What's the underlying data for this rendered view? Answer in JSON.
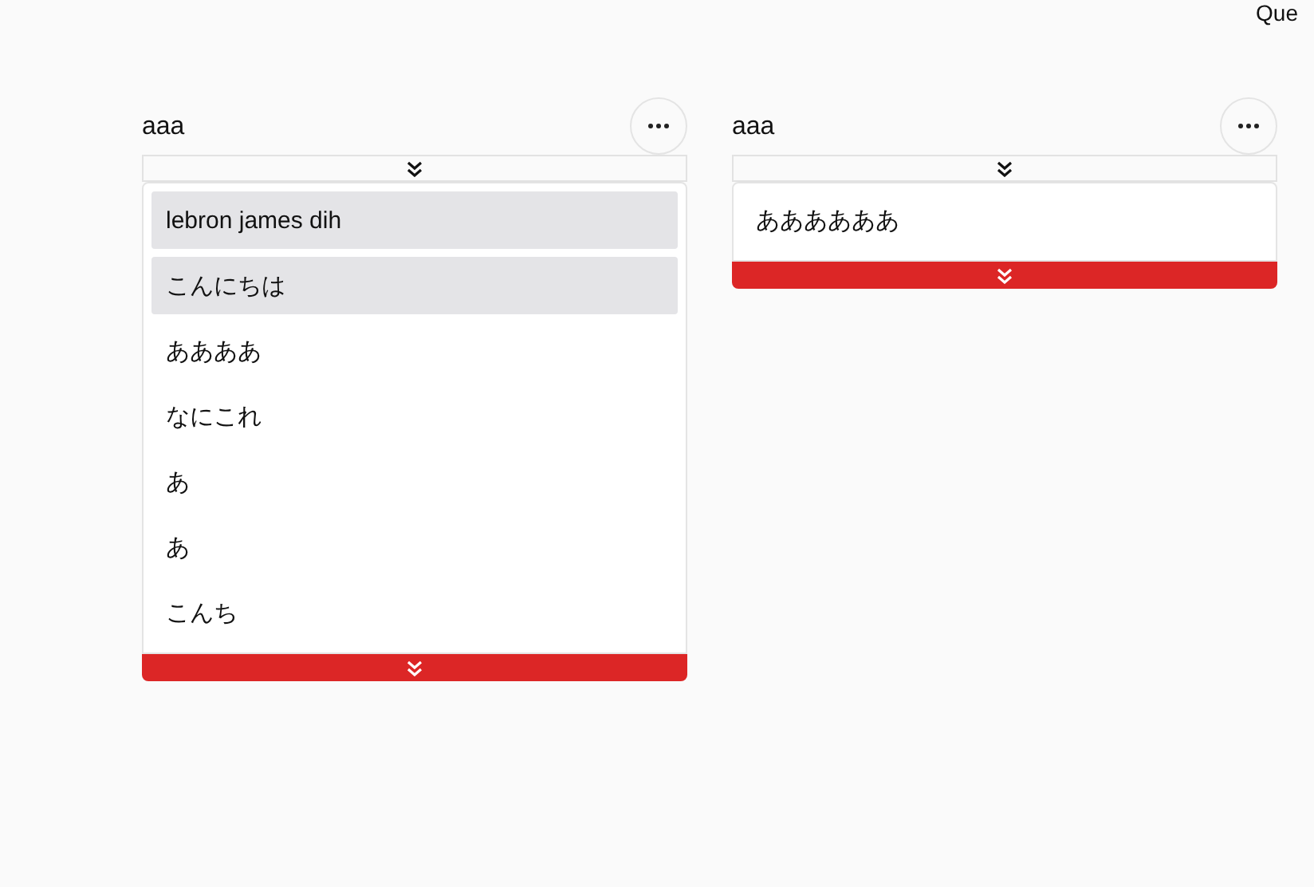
{
  "header": {
    "text": "Que"
  },
  "columns": [
    {
      "title": "aaa",
      "items": [
        {
          "label": "lebron james dih",
          "selected": true
        },
        {
          "label": "こんにちは",
          "selected": true
        },
        {
          "label": "ああああ",
          "selected": false
        },
        {
          "label": "なにこれ",
          "selected": false
        },
        {
          "label": "あ",
          "selected": false
        },
        {
          "label": "あ",
          "selected": false
        },
        {
          "label": "こんち",
          "selected": false
        }
      ]
    },
    {
      "title": "aaa",
      "items": [
        {
          "label": "ああああああ",
          "selected": false
        }
      ]
    }
  ]
}
